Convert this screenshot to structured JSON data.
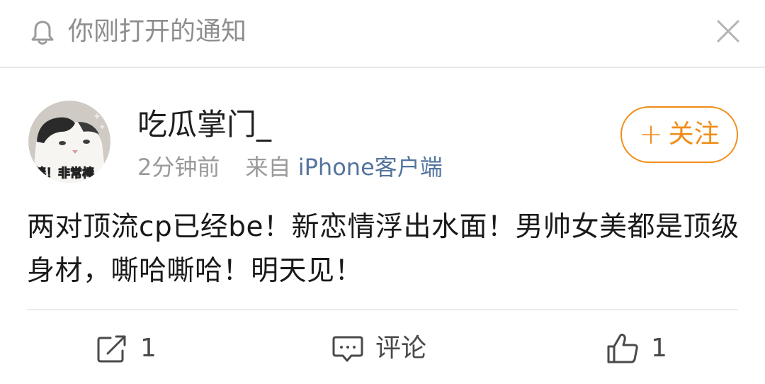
{
  "notification": {
    "title": "你刚打开的通知",
    "icon": "bell-icon",
    "close_icon": "close-icon"
  },
  "post": {
    "author": "吃瓜掌门_",
    "avatar_caption": "棒！非常棒",
    "time": "2分钟前",
    "source_prefix": "来自",
    "source": "iPhone客户端",
    "follow_label": "关注",
    "follow_plus": "+",
    "text": "两对顶流cp已经be！新恋情浮出水面！男帅女美都是顶级身材，嘶哈嘶哈！明天见！"
  },
  "actions": {
    "repost_count": "1",
    "comment_label": "评论",
    "like_count": "1"
  },
  "colors": {
    "accent_orange": "#f08d19",
    "link_blue": "#54749e",
    "muted_gray": "#9a9a9a"
  }
}
